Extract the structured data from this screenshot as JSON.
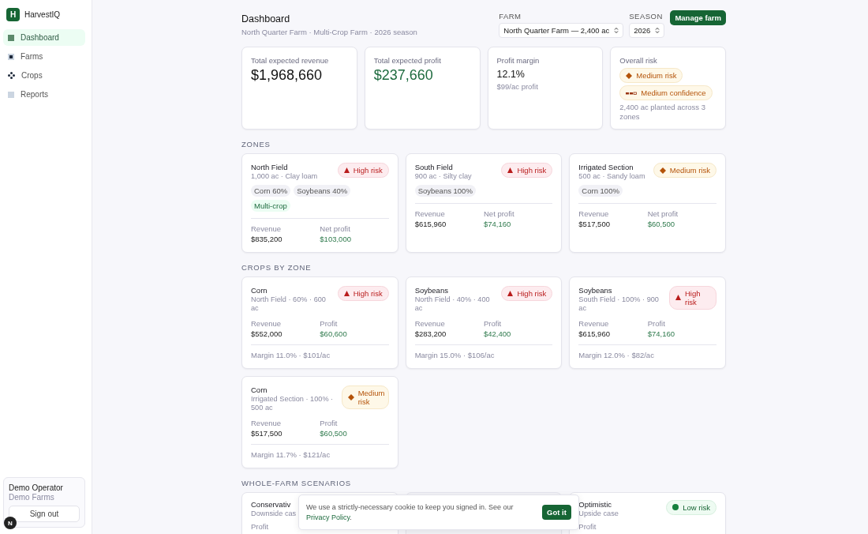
{
  "sidebar": {
    "logo_letter": "H",
    "brand": "HarvestIQ",
    "items": [
      {
        "label": "Dashboard",
        "selected": true
      },
      {
        "label": "Farms",
        "selected": false
      },
      {
        "label": "Crops",
        "selected": false
      },
      {
        "label": "Reports",
        "selected": false
      }
    ],
    "user": {
      "name": "Demo Operator",
      "org": "Demo Farms",
      "sign_out": "Sign out"
    },
    "dev_badge": "N"
  },
  "header": {
    "title": "Dashboard",
    "subtitle": "North Quarter Farm · Multi-Crop Farm · 2026 season",
    "farm_label": "FARM",
    "farm_value": "North Quarter Farm — 2,400 ac",
    "season_label": "SEASON",
    "season_value": "2026",
    "manage_button": "Manage farm"
  },
  "summary": [
    {
      "label": "Total expected revenue",
      "value": "$1,968,660",
      "kind": "plain"
    },
    {
      "label": "Total expected profit",
      "value": "$237,660",
      "kind": "positive"
    },
    {
      "label": "Profit margin",
      "value": "12.1%",
      "note": "$99/ac profit",
      "kind": "small"
    },
    {
      "label": "Overall risk",
      "kind": "risk",
      "badges": [
        {
          "text": "Medium risk",
          "kind": "medium"
        },
        {
          "text": "Medium confidence",
          "kind": "confidence"
        }
      ],
      "note": "2,400 ac planted across 3 zones"
    }
  ],
  "zones_heading": "ZONES",
  "zones": [
    {
      "name": "North Field",
      "detail": "1,000 ac · Clay loam",
      "badge": "High risk",
      "kind": "high",
      "tags": [
        {
          "text": "Corn 60%",
          "kind": "crop"
        },
        {
          "text": "Soybeans 40%",
          "kind": "crop"
        },
        {
          "text": "Multi-crop",
          "kind": "multi"
        }
      ],
      "revenue_label": "Revenue",
      "revenue": "$835,200",
      "profit_label": "Net profit",
      "profit": "$103,000"
    },
    {
      "name": "South Field",
      "detail": "900 ac · Silty clay",
      "badge": "High risk",
      "kind": "high",
      "tags": [
        {
          "text": "Soybeans 100%",
          "kind": "crop"
        }
      ],
      "revenue_label": "Revenue",
      "revenue": "$615,960",
      "profit_label": "Net profit",
      "profit": "$74,160"
    },
    {
      "name": "Irrigated Section",
      "detail": "500 ac · Sandy loam",
      "badge": "Medium risk",
      "kind": "medium",
      "tags": [
        {
          "text": "Corn 100%",
          "kind": "crop"
        }
      ],
      "revenue_label": "Revenue",
      "revenue": "$517,500",
      "profit_label": "Net profit",
      "profit": "$60,500"
    }
  ],
  "crops_heading": "CROPS BY ZONE",
  "crops": [
    {
      "name": "Corn",
      "detail": "North Field · 60% · 600 ac",
      "badge": "High risk",
      "kind": "high",
      "revenue_label": "Revenue",
      "revenue": "$552,000",
      "profit_label": "Profit",
      "profit": "$60,600",
      "margin": "Margin 11.0% · $101/ac"
    },
    {
      "name": "Soybeans",
      "detail": "North Field · 40% · 400 ac",
      "badge": "High risk",
      "kind": "high",
      "revenue_label": "Revenue",
      "revenue": "$283,200",
      "profit_label": "Profit",
      "profit": "$42,400",
      "margin": "Margin 15.0% · $106/ac"
    },
    {
      "name": "Soybeans",
      "detail": "South Field · 100% · 900 ac",
      "badge": "High risk",
      "kind": "high",
      "revenue_label": "Revenue",
      "revenue": "$615,960",
      "profit_label": "Profit",
      "profit": "$74,160",
      "margin": "Margin 12.0% · $82/ac"
    },
    {
      "name": "Corn",
      "detail": "Irrigated Section · 100% · 500 ac",
      "badge": "Medium risk",
      "kind": "medium",
      "revenue_label": "Revenue",
      "revenue": "$517,500",
      "profit_label": "Profit",
      "profit": "$60,500",
      "margin": "Margin 11.7% · $121/ac"
    }
  ],
  "scenarios_heading": "WHOLE-FARM SCENARIOS",
  "scenarios": [
    {
      "name": "Conservativ",
      "detail": "Downside cas",
      "profit_label": "Profit"
    },
    {
      "kind": "covered"
    },
    {
      "name": "Optimistic",
      "detail": "Upside case",
      "badge": "Low risk",
      "kind": "low",
      "profit_label": "Profit"
    }
  ],
  "cookie_banner": {
    "text": "We use a strictly-necessary cookie to keep you signed in. See our ",
    "link": "Privacy Policy",
    "after": ".",
    "button": "Got it"
  }
}
